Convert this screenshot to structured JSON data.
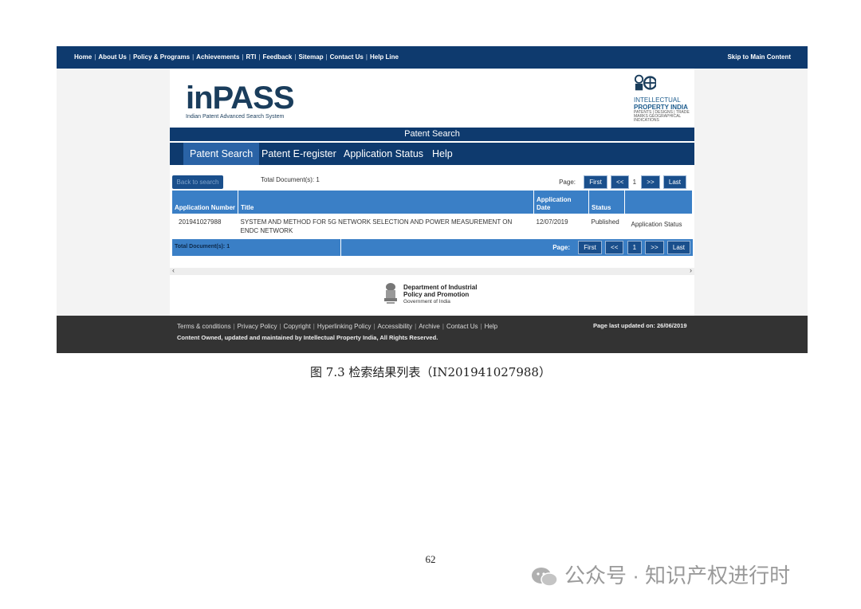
{
  "topnav": {
    "links": [
      "Home",
      "About Us",
      "Policy & Programs",
      "Achievements",
      "RTI",
      "Feedback",
      "Sitemap",
      "Contact Us",
      "Help Line"
    ],
    "skip": "Skip to Main Content"
  },
  "header": {
    "logo_text": "inPASS",
    "logo_sub": "Indian Patent Advanced Search System",
    "ipi_line1": "INTELLECTUAL",
    "ipi_line2": "PROPERTY INDIA",
    "ipi_small": "PATENTS | DESIGNS | TRADE MARKS GEOGRAPHICAL INDICATIONS"
  },
  "section_title": "Patent Search",
  "tabs": [
    {
      "label": "Patent Search",
      "active": true
    },
    {
      "label": "Patent E-register",
      "active": false
    },
    {
      "label": "Application Status",
      "active": false
    },
    {
      "label": "Help",
      "active": false
    }
  ],
  "toolbar": {
    "back_label": "Back to search",
    "total_docs": "Total Document(s): 1",
    "page_label": "Page:",
    "first": "First",
    "prev": "<<",
    "page_num": "1",
    "next": ">>",
    "last": "Last"
  },
  "table": {
    "headers": [
      "Application Number",
      "Title",
      "Application Date",
      "Status",
      ""
    ],
    "rows": [
      {
        "app_no": "201941027988",
        "title": "SYSTEM AND METHOD FOR 5G NETWORK SELECTION AND POWER MEASUREMENT ON ENDC NETWORK",
        "date": "12/07/2019",
        "status": "Published",
        "link": "Application Status"
      }
    ]
  },
  "footer_row": {
    "total_docs": "Total Document(s): 1",
    "page_label": "Page:"
  },
  "dipp": {
    "line1": "Department of Industrial",
    "line2": "Policy and Promotion",
    "line3": "Government of India"
  },
  "site_footer": {
    "links": [
      "Terms & conditions",
      "Privacy Policy",
      "Copyright",
      "Hyperlinking Policy",
      "Accessibility",
      "Archive",
      "Contact Us",
      "Help"
    ],
    "owned": "Content Owned, updated and maintained by Intellectual Property India, All Rights Reserved.",
    "updated": "Page last updated on: 26/06/2019"
  },
  "caption": "图 7.3  检索结果列表（IN201941027988）",
  "page_number": "62",
  "watermark": "公众号 · 知识产权进行时"
}
